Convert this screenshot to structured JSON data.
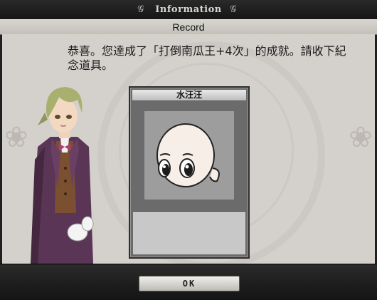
{
  "header": {
    "title": "Information",
    "decor_glyph": "&"
  },
  "dialog": {
    "record_title": "Record",
    "message": "恭喜。您達成了「打倒南瓜王+4次」的成就。請收下紀念道具。"
  },
  "reward_card": {
    "item_name": "水汪汪",
    "image_icon": "crying-face-icon"
  },
  "footer": {
    "ok_label": "OK"
  },
  "colors": {
    "panel_bg": "#d4d1cc",
    "frame_dark": "#202020",
    "coat_purple": "#5a3555",
    "hair_green": "#a8b070"
  }
}
